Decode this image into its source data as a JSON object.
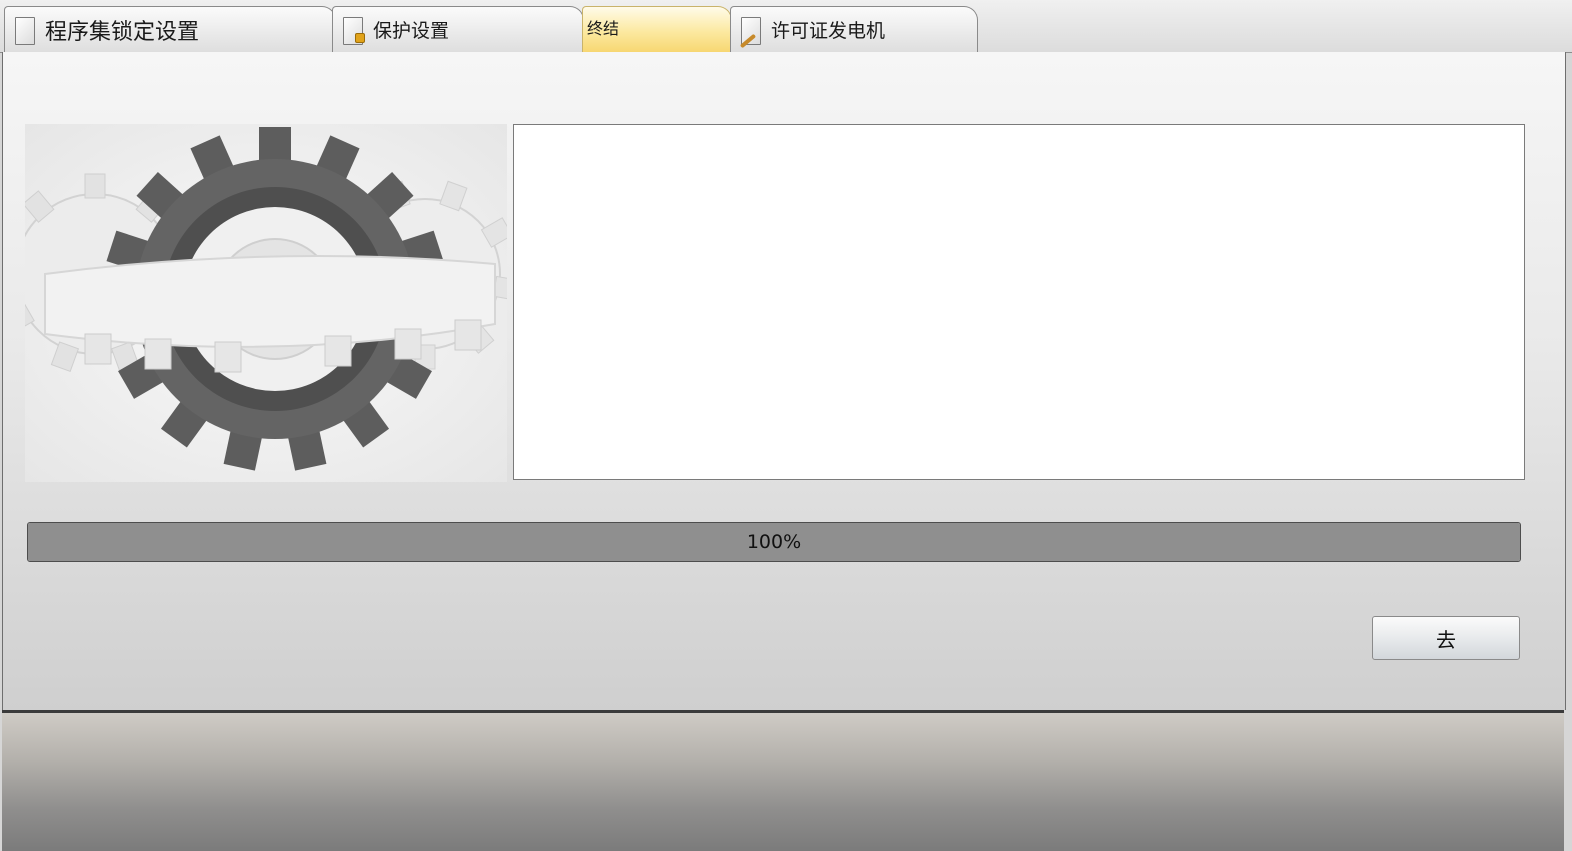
{
  "tabs": [
    {
      "label": "程序集锁定设置",
      "icon": "document-icon"
    },
    {
      "label": "保护设置",
      "icon": "document-lock-icon"
    },
    {
      "label": "终结",
      "icon": "none"
    },
    {
      "label": "许可证发电机",
      "icon": "document-pen-icon"
    }
  ],
  "active_tab_index": 2,
  "log_box": {
    "content": ""
  },
  "progress": {
    "value_percent": 100,
    "label": "100%"
  },
  "go_button": {
    "label": "去"
  },
  "colors": {
    "active_tab": "#fce9a0",
    "progress_fill": "#8f8f8f",
    "gear_dark": "#5d5d5d",
    "gear_light": "#e9e9e9"
  }
}
